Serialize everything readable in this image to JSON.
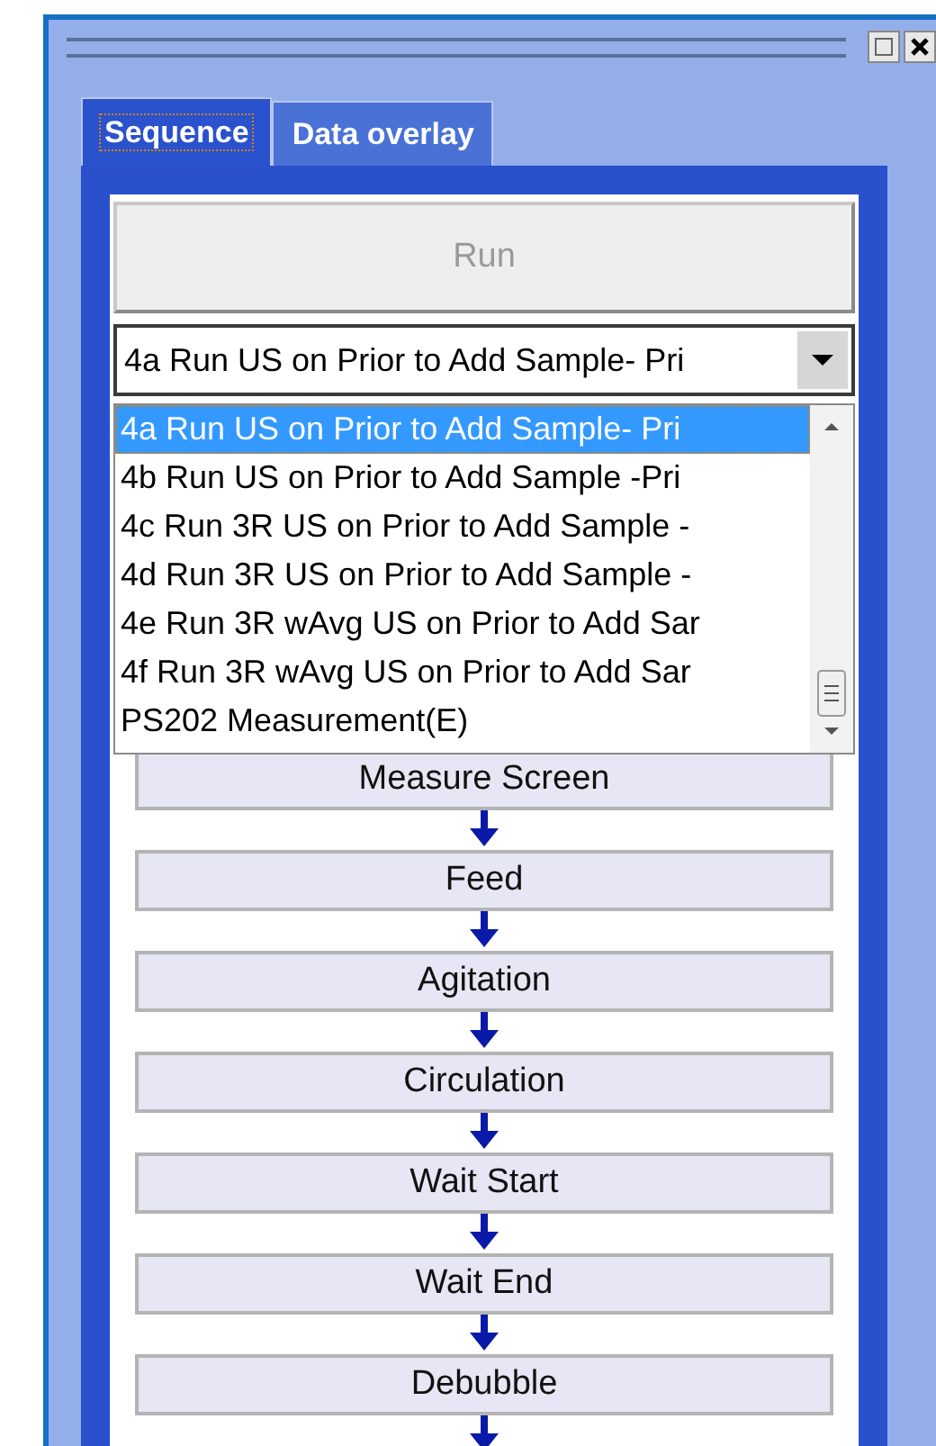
{
  "tabs": [
    {
      "label": "Sequence",
      "selected": true
    },
    {
      "label": "Data overlay",
      "selected": false
    }
  ],
  "run_button": {
    "label": "Run",
    "disabled": true
  },
  "sequence_select": {
    "value": "4a Run US on Prior to Add Sample- Pri",
    "expanded": true
  },
  "dropdown_options": [
    {
      "label": "4a Run US on Prior to Add Sample- Pri",
      "selected": true
    },
    {
      "label": "4b Run US on Prior to Add Sample -Pri",
      "selected": false
    },
    {
      "label": "4c Run 3R US on Prior to Add Sample -",
      "selected": false
    },
    {
      "label": "4d Run 3R US on Prior to Add Sample -",
      "selected": false
    },
    {
      "label": "4e Run 3R wAvg US on Prior to Add Sar",
      "selected": false
    },
    {
      "label": "4f Run 3R wAvg US on Prior to Add Sar",
      "selected": false
    },
    {
      "label": "PS202 Measurement(E)",
      "selected": false
    }
  ],
  "steps": [
    {
      "label": "Measure Screen"
    },
    {
      "label": "Feed"
    },
    {
      "label": "Agitation"
    },
    {
      "label": "Circulation"
    },
    {
      "label": "Wait Start"
    },
    {
      "label": "Wait End"
    },
    {
      "label": "Debubble"
    }
  ]
}
